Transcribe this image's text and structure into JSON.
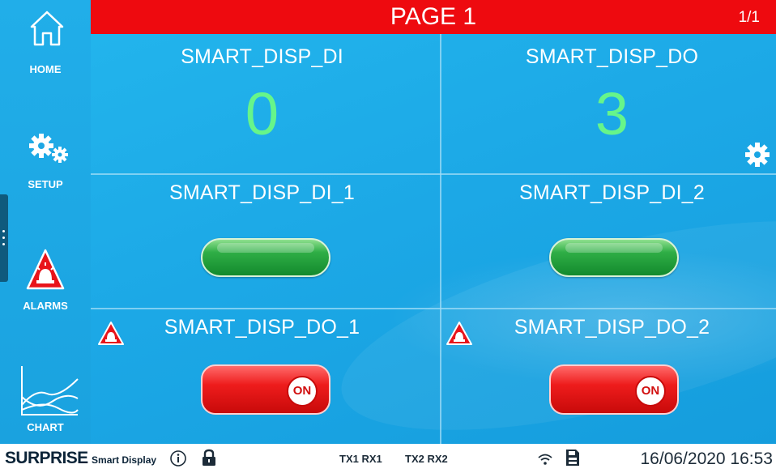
{
  "header": {
    "title": "PAGE 1",
    "pager": "1/1",
    "color": "#ee0a0f"
  },
  "sidebar": {
    "items": [
      {
        "label": "HOME",
        "icon": "home-icon"
      },
      {
        "label": "SETUP",
        "icon": "gears-icon"
      },
      {
        "label": "ALARMS",
        "icon": "alarm-icon"
      },
      {
        "label": "CHART",
        "icon": "chart-icon"
      }
    ]
  },
  "cells": [
    {
      "title": "SMART_DISP_DI",
      "value": "0",
      "type": "numeric"
    },
    {
      "title": "SMART_DISP_DO",
      "value": "3",
      "type": "numeric"
    },
    {
      "title": "SMART_DISP_DI_1",
      "type": "indicator",
      "state": "on",
      "color": "#2fae46"
    },
    {
      "title": "SMART_DISP_DI_2",
      "type": "indicator",
      "state": "on",
      "color": "#2fae46"
    },
    {
      "title": "SMART_DISP_DO_1",
      "type": "toggle",
      "state": "ON",
      "alarm_icon": true,
      "color": "#ee1c1c"
    },
    {
      "title": "SMART_DISP_DO_2",
      "type": "toggle",
      "state": "ON",
      "alarm_icon": true,
      "color": "#ee1c1c"
    }
  ],
  "footer": {
    "brand_main": "SURPRISE",
    "brand_sub": "Smart Display",
    "port1": "TX1 RX1",
    "port2": "TX2 RX2",
    "datetime": "16/06/2020 16:53",
    "icons": [
      "info-icon",
      "lock-icon",
      "wifi-icon",
      "sd-card-icon"
    ]
  },
  "colors": {
    "background": "#1fa9e6",
    "value_green": "#66f58a",
    "alarm_red": "#e8141a"
  }
}
